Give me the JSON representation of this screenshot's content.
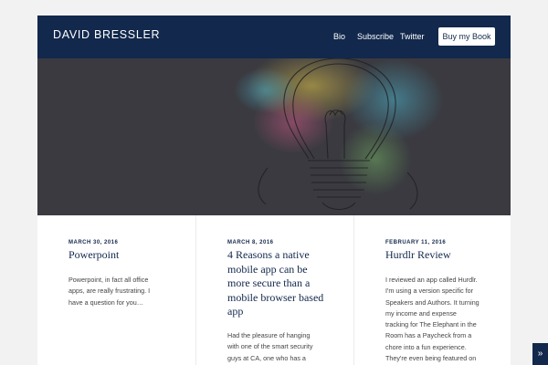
{
  "site": {
    "title": "DAVID BRESSLER"
  },
  "nav": {
    "bio": "Bio",
    "subscribe": "Subscribe",
    "twitter": "Twitter",
    "cta": "Buy my Book"
  },
  "posts": [
    {
      "date": "MARCH 30, 2016",
      "title": "Powerpoint",
      "excerpt": "Powerpoint, in fact all office apps, are really frustrating. I have a question for you…"
    },
    {
      "date": "MARCH 8, 2016",
      "title": "4 Reasons a native mobile app can be more secure than a mobile browser based app",
      "excerpt": "Had the pleasure of hanging with one of the smart security guys at CA, one who has a clarity of"
    },
    {
      "date": "FEBRUARY 11, 2016",
      "title": "Hurdlr Review",
      "excerpt": "I reviewed an app called Hurdlr. I'm using a version specific for Speakers and Authors. It turning my income and expense tracking for The Elephant in the Room has a Paycheck from a chore into a fun experience. They're even being featured on Product Hunt."
    }
  ],
  "scroll_button": "»",
  "colors": {
    "brand": "#12284c",
    "hero_bg": "#3a3a40"
  }
}
